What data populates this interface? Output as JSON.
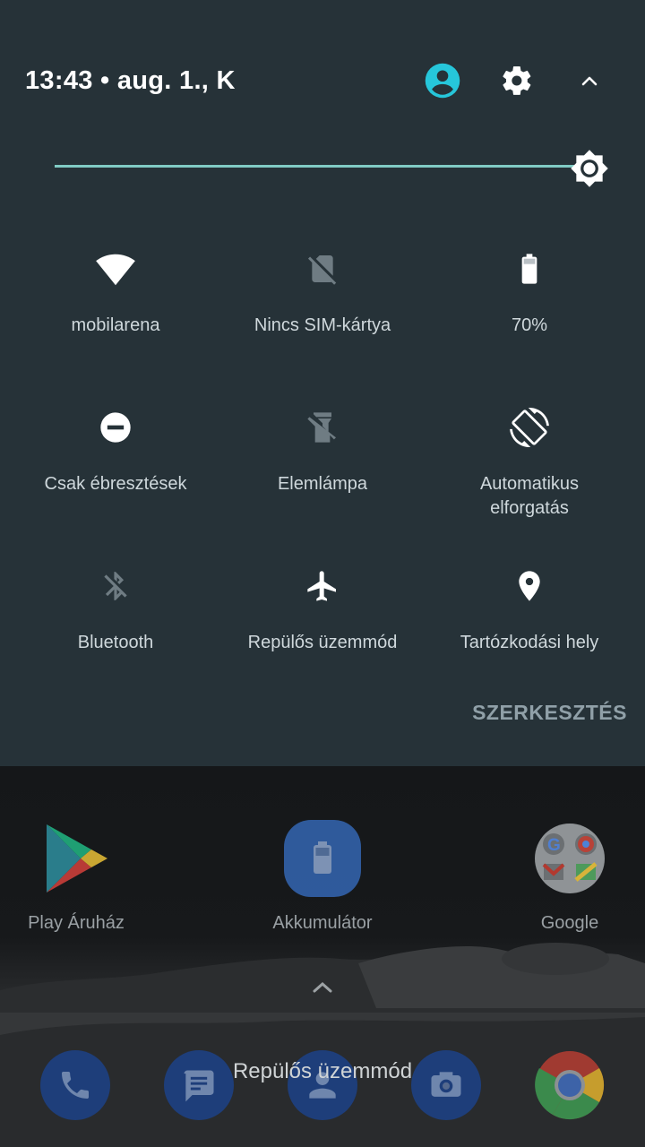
{
  "status": {
    "time_date": "13:43 • aug. 1., K"
  },
  "header_icons": {
    "avatar": "account-circle-icon",
    "settings": "gear-icon",
    "collapse": "chevron-up-icon"
  },
  "brightness": {
    "level_fraction": 1.0,
    "accent_color": "#80cbc4"
  },
  "tiles": [
    {
      "label": "mobilarena",
      "icon": "wifi-icon",
      "active": true
    },
    {
      "label": "Nincs SIM-kártya",
      "icon": "no-sim-icon",
      "active": false
    },
    {
      "label": "70%",
      "icon": "battery-icon",
      "active": true
    },
    {
      "label": "Csak ébresztések",
      "icon": "do-not-disturb-icon",
      "active": true
    },
    {
      "label": "Elemlámpa",
      "icon": "flashlight-off-icon",
      "active": false
    },
    {
      "label": "Automatikus elforgatás",
      "icon": "auto-rotate-icon",
      "active": true
    },
    {
      "label": "Bluetooth",
      "icon": "bluetooth-off-icon",
      "active": false
    },
    {
      "label": "Repülős üzemmód",
      "icon": "airplane-icon",
      "active": true
    },
    {
      "label": "Tartózkodási hely",
      "icon": "location-icon",
      "active": true
    }
  ],
  "edit_label": "SZERKESZTÉS",
  "home": {
    "apps": [
      {
        "label": "Play Áruház",
        "icon": "play-store-icon"
      },
      {
        "label": "Akkumulátor",
        "icon": "battery-app-icon"
      },
      {
        "label": "Google",
        "icon": "google-folder-icon"
      }
    ],
    "dock": [
      "phone-icon",
      "messages-icon",
      "contacts-icon",
      "camera-icon",
      "chrome-icon"
    ],
    "toast": "Repülős üzemmód"
  },
  "colors": {
    "panel_bg": "#263238",
    "tile_active": "#ffffff",
    "tile_inactive": "#6f7c83",
    "avatar": "#26c6da"
  }
}
